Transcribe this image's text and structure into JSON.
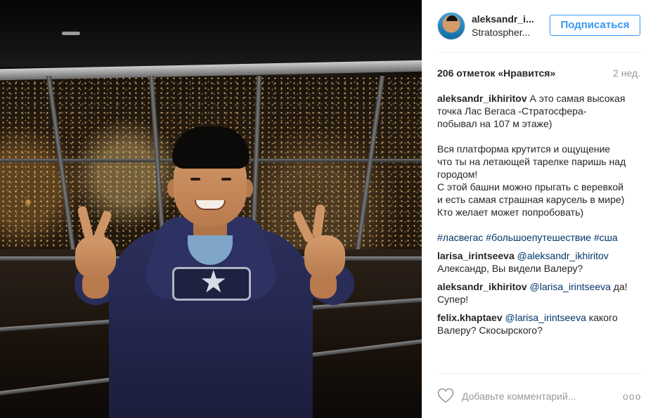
{
  "post": {
    "username": "aleksandr_i...",
    "location": "Stratospher...",
    "follow_label": "Подписаться",
    "likes": "206 отметок «Нравится»",
    "time_ago": "2 нед."
  },
  "caption": {
    "user": "aleksandr_ikhiritov",
    "line1": "А это самая высокая",
    "line2": "точка Лас Вегаса -Стратосфера-",
    "line3": "побывал на 107 м этаже)",
    "line4": "Вся платформа крутится и ощущение",
    "line5": "что ты на летающей тарелке паришь над",
    "line6": "городом!",
    "line7": "С этой башни можно прыгать с веревкой",
    "line8": "и есть самая страшная карусель в мире)",
    "line9": "Кто желает может попробовать)",
    "tags": [
      "#ласвегас",
      "#большоепутешествие",
      "#сша"
    ]
  },
  "comments": [
    {
      "user": "larisa_irintseeva",
      "mention": "@aleksandr_ikhiritov",
      "text": "Александр, Вы видели Валеру?"
    },
    {
      "user": "aleksandr_ikhiritov",
      "mention": "@larisa_irintseeva",
      "text": "да!",
      "text2": "Супер!"
    },
    {
      "user": "felix.khaptaev",
      "mention": "@larisa_irintseeva",
      "text": "какого",
      "text2": "Валеру? Скосырского?"
    }
  ],
  "footer": {
    "add_comment_placeholder": "Добавьте комментарий...",
    "more_label": "ooo"
  },
  "colors": {
    "accent": "#3897f0",
    "link": "#003569",
    "muted": "#999999",
    "text": "#262626"
  },
  "icons": {
    "like": "heart-icon",
    "more": "more-options-icon"
  }
}
